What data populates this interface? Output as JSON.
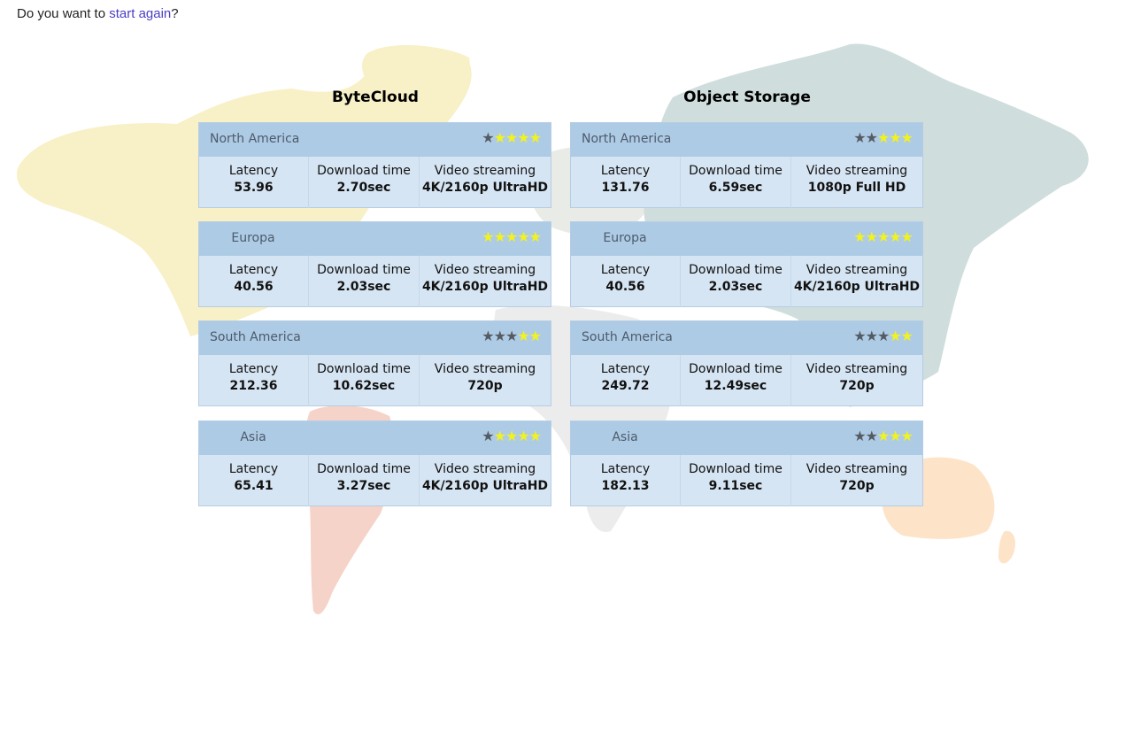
{
  "prompt": {
    "before": "Do you want to ",
    "link": "start again",
    "after": "?"
  },
  "labels": {
    "latency": "Latency",
    "download": "Download time",
    "video": "Video streaming"
  },
  "colors": {
    "header": "#aecbe5",
    "body": "#d6e5f3",
    "star_dark": "#555b63",
    "star_lit": "#f2f21c",
    "link": "#4a3fc4"
  },
  "providers": [
    {
      "name": "ByteCloud",
      "regions": [
        {
          "name": "North America",
          "dark_stars": 1,
          "lit_stars": 4,
          "latency": "53.96",
          "download": "2.70sec",
          "video": "4K/2160p UltraHD"
        },
        {
          "name": "Europa",
          "dark_stars": 0,
          "lit_stars": 5,
          "latency": "40.56",
          "download": "2.03sec",
          "video": "4K/2160p UltraHD"
        },
        {
          "name": "South America",
          "dark_stars": 3,
          "lit_stars": 2,
          "latency": "212.36",
          "download": "10.62sec",
          "video": "720p"
        },
        {
          "name": "Asia",
          "dark_stars": 1,
          "lit_stars": 4,
          "latency": "65.41",
          "download": "3.27sec",
          "video": "4K/2160p UltraHD"
        }
      ]
    },
    {
      "name": "Object Storage",
      "regions": [
        {
          "name": "North America",
          "dark_stars": 2,
          "lit_stars": 3,
          "latency": "131.76",
          "download": "6.59sec",
          "video": "1080p Full HD"
        },
        {
          "name": "Europa",
          "dark_stars": 0,
          "lit_stars": 5,
          "latency": "40.56",
          "download": "2.03sec",
          "video": "4K/2160p UltraHD"
        },
        {
          "name": "South America",
          "dark_stars": 3,
          "lit_stars": 2,
          "latency": "249.72",
          "download": "12.49sec",
          "video": "720p"
        },
        {
          "name": "Asia",
          "dark_stars": 2,
          "lit_stars": 3,
          "latency": "182.13",
          "download": "9.11sec",
          "video": "720p"
        }
      ]
    }
  ]
}
